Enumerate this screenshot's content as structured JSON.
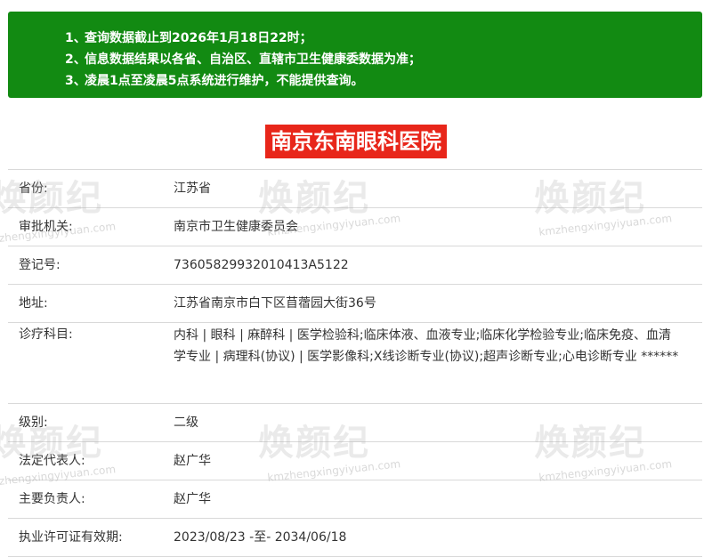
{
  "notice": {
    "line1_num": "1、",
    "line1": "查询数据截止到2026年1月18日22时；",
    "line2_num": "2、",
    "line2": "信息数据结果以各省、自治区、直辖市卫生健康委数据为准；",
    "line3_num": "3、",
    "line3_bold": "凌晨1点至凌晨5点",
    "line3_rest": "系统进行维护，不能提供查询。"
  },
  "title": "南京东南眼科医院",
  "rows": [
    {
      "label": "省份:",
      "value": "江苏省"
    },
    {
      "label": "审批机关:",
      "value": "南京市卫生健康委员会"
    },
    {
      "label": "登记号:",
      "value": "73605829932010413A5122"
    },
    {
      "label": "地址:",
      "value": "江苏省南京市白下区苜蓿园大街36号"
    },
    {
      "label": "诊疗科目:",
      "value": "内科 | 眼科 | 麻醉科 | 医学检验科;临床体液、血液专业;临床化学检验专业;临床免疫、血清学专业 | 病理科(协议) | 医学影像科;X线诊断专业(协议);超声诊断专业;心电诊断专业 ******"
    },
    {
      "label": "级别:",
      "value": "二级"
    },
    {
      "label": "法定代表人:",
      "value": "赵广华"
    },
    {
      "label": "主要负责人:",
      "value": "赵广华"
    },
    {
      "label": "执业许可证有效期:",
      "value": "2023/08/23 -至- 2034/06/18"
    }
  ],
  "watermark": {
    "text": "焕颜纪",
    "url": "kmzhengxingyiyuan.com"
  }
}
